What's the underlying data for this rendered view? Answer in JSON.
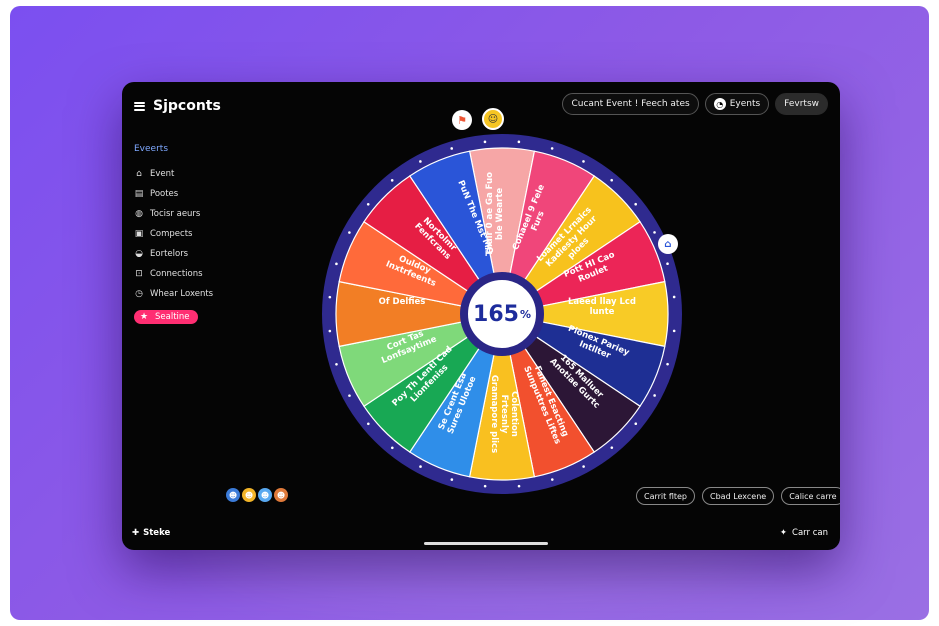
{
  "app": {
    "title": "Sjpconts"
  },
  "header": {
    "buttons": [
      {
        "label": "Cucant Event ! Feech ates"
      },
      {
        "label": "Eyents",
        "icon": "clock-icon"
      },
      {
        "label": "Fevrtsw"
      }
    ]
  },
  "sidebar": {
    "heading": "Eveerts",
    "items": [
      {
        "label": "Event",
        "icon": "home-icon"
      },
      {
        "label": "Pootes",
        "icon": "folder-icon"
      },
      {
        "label": "Tocisr aeurs",
        "icon": "globe-icon"
      },
      {
        "label": "Compects",
        "icon": "box-icon"
      },
      {
        "label": "Eortelors",
        "icon": "layers-icon"
      },
      {
        "label": "Connections",
        "icon": "link-icon"
      },
      {
        "label": "Whear Loxents",
        "icon": "timer-icon"
      },
      {
        "label": "Sealtine",
        "icon": "star-icon",
        "active": true
      }
    ]
  },
  "wheel": {
    "center_value": "165",
    "center_unit": "%",
    "segments": [
      {
        "label": "Thair 0 ae Ga Fuo ble Wearte",
        "color": "#f6a6a6"
      },
      {
        "label": "Cohaeel 9 Fele Furs",
        "color": "#f0467a"
      },
      {
        "label": "Loamet Lrnaics Kadiesty Hour ploes",
        "color": "#f7c21d"
      },
      {
        "label": "Pott HI Cao Roulet",
        "color": "#ec2557"
      },
      {
        "label": "Laeed llay Lcd lunte",
        "color": "#f8cb26"
      },
      {
        "label": "Pionex Pariey Intllter",
        "color": "#1e2f94"
      },
      {
        "label": "165 Malluer Anotiae Gurtc",
        "color": "#2c1636"
      },
      {
        "label": "Fanest Esacting Sunputtres Liftes",
        "color": "#f2502e"
      },
      {
        "label": "Colention Frtesnly Gramapore plics",
        "color": "#f9c020"
      },
      {
        "label": "Se Crent Esa Sures Ulotoe",
        "color": "#2f8ee9"
      },
      {
        "label": "Poy Th Lentl Cad Lionfeniss",
        "color": "#18a854"
      },
      {
        "label": "Cort Tas Lonfsaytime",
        "color": "#7fd97a"
      },
      {
        "label": "Of Delfies",
        "color": "#f27e25"
      },
      {
        "label": "Ouldoy Inxtrfeents",
        "color": "#ff6a3a"
      },
      {
        "label": "Nortolmr Fenfcrans",
        "color": "#e61e44"
      },
      {
        "label": "PuN The Mst MO",
        "color": "#2a55d8"
      }
    ]
  },
  "participants": [
    {
      "icon": "avatar-icon",
      "color": "#3b7bd8"
    },
    {
      "icon": "avatar-icon",
      "color": "#f2b428"
    },
    {
      "icon": "avatar-icon",
      "color": "#58a8f0"
    },
    {
      "icon": "avatar-icon",
      "color": "#e07a3a"
    }
  ],
  "actions": [
    {
      "label": "Carrit fltep"
    },
    {
      "label": "Cbad Lexcene"
    },
    {
      "label": "Calice carre"
    }
  ],
  "footer": {
    "left_label": "Steke",
    "right_label": "Carr can"
  }
}
